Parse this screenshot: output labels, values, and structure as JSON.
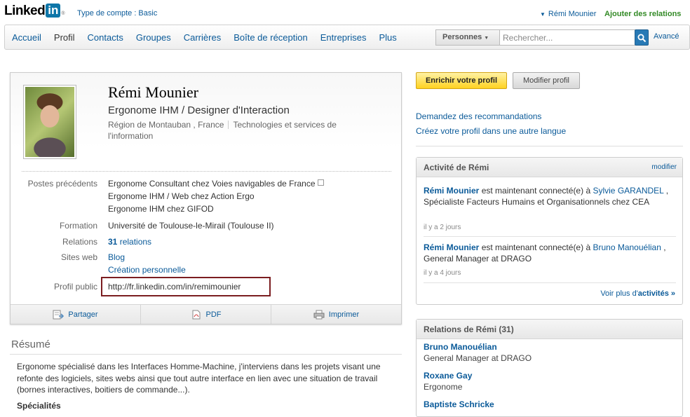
{
  "header": {
    "logo_text": "Linked",
    "logo_in": "in",
    "logo_mark": "®",
    "account_type": "Type de compte : Basic",
    "user_name": "Rémi Mounier",
    "add_relations": "Ajouter des relations"
  },
  "nav": {
    "items": [
      {
        "label": "Accueil"
      },
      {
        "label": "Profil"
      },
      {
        "label": "Contacts"
      },
      {
        "label": "Groupes"
      },
      {
        "label": "Carrières"
      },
      {
        "label": "Boîte de réception"
      },
      {
        "label": "Entreprises"
      },
      {
        "label": "Plus"
      }
    ],
    "active": "Profil",
    "search_type": "Personnes",
    "search_placeholder": "Rechercher...",
    "advanced": "Avancé"
  },
  "profile": {
    "name": "Rémi Mounier",
    "headline": "Ergonome IHM / Designer d'Interaction",
    "region": "Région de Montauban , France",
    "industry": "Technologies et services de l'information",
    "labels": {
      "previous": "Postes précédents",
      "education": "Formation",
      "relations": "Relations",
      "websites": "Sites web",
      "public": "Profil public"
    },
    "previous": [
      "Ergonome Consultant chez Voies navigables de France",
      "Ergonome IHM / Web chez Action Ergo",
      "Ergonome IHM chez GIFOD"
    ],
    "education": "Université de Toulouse-le-Mirail (Toulouse II)",
    "relations_count": "31",
    "relations_text": "relations",
    "websites": [
      "Blog",
      "Création personnelle"
    ],
    "public_url": "http://fr.linkedin.com/in/remimounier",
    "actions": {
      "share": "Partager",
      "pdf": "PDF",
      "print": "Imprimer"
    }
  },
  "summary": {
    "title": "Résumé",
    "text": "Ergonome spécialisé dans les Interfaces Homme-Machine, j'interviens dans les projets visant une refonte des logiciels, sites webs ainsi que tout autre interface en lien avec une situation de travail (bornes interactives, boitiers de commande...).",
    "specialties_label": "Spécialités"
  },
  "sidebar": {
    "enrich_button": "Enrichir votre profil",
    "edit_button": "Modifier profil",
    "links": [
      "Demandez des recommandations",
      "Créez votre profil dans une autre langue"
    ],
    "activity": {
      "title": "Activité de Rémi",
      "edit": "modifier",
      "items": [
        {
          "actor": "Rémi Mounier",
          "text": "est maintenant connecté(e) à",
          "target": "Sylvie GARANDEL",
          "rest": ", Spécialiste Facteurs Humains et Organisationnels chez CEA",
          "time": "il y a 2 jours"
        },
        {
          "actor": "Rémi Mounier",
          "text": "est maintenant connecté(e) à",
          "target": "Bruno Manouélian",
          "rest": ", General Manager at DRAGO",
          "time": "il y a 4 jours"
        }
      ],
      "more_prefix": "Voir plus d'",
      "more_link": "activités »"
    },
    "relations": {
      "title": "Relations de Rémi (31)",
      "items": [
        {
          "name": "Bruno Manouélian",
          "title": "General Manager at DRAGO"
        },
        {
          "name": "Roxane Gay",
          "title": "Ergonome"
        },
        {
          "name": "Baptiste Schricke",
          "title": ""
        }
      ]
    }
  }
}
